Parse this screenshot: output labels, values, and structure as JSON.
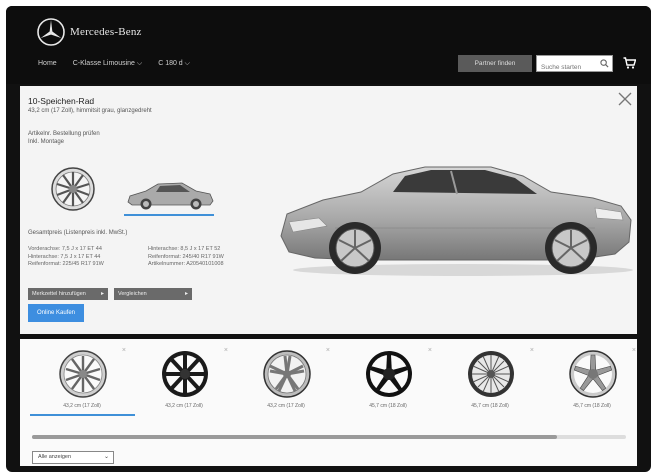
{
  "header": {
    "brand": "Mercedes-Benz",
    "nav": [
      "Home",
      "C-Klasse Limousine ⌵",
      "C 180 d ⌵"
    ],
    "dealer_button": "Partner finden",
    "search_placeholder": "Suche starten",
    "icons": {
      "logo": "mercedes-star-logo",
      "search": "search-icon",
      "cart": "cart-icon"
    }
  },
  "panel": {
    "title": "10-Speichen-Rad",
    "subtitle": "43,2 cm (17 Zoll), himmitsit grau, glanzgedreht",
    "info_lines": [
      "Artikelnr. Bestellung prüfen",
      "Inkl. Montage"
    ],
    "section_label": "Gesamtpreis (Listenpreis inkl. MwSt.)",
    "specs_left": [
      "Vorderachse: 7,5 J x 17 ET 44",
      "Hinterachse: 7,5 J x 17 ET 44",
      "Reifenformat: 225/45 R17 91W"
    ],
    "specs_right": [
      "Hinterachse: 8,5 J x 17 ET 52",
      "Reifenformat: 245/40 R17 91W",
      "Artikelnummer: A20540101008"
    ],
    "button_add": "Merkzettel hinzufügen",
    "button_compare": "Vergleichen",
    "button_primary": "Online Kaufen"
  },
  "wheels": [
    {
      "label": "43,2 cm (17 Zoll)",
      "selected": true,
      "style": "multispoke-silver"
    },
    {
      "label": "43,2 cm (17 Zoll)",
      "selected": false,
      "style": "black-multispoke"
    },
    {
      "label": "43,2 cm (17 Zoll)",
      "selected": false,
      "style": "silver-5-twin"
    },
    {
      "label": "45,7 cm (18 Zoll)",
      "selected": false,
      "style": "black-5-spoke"
    },
    {
      "label": "45,7 cm (18 Zoll)",
      "selected": false,
      "style": "mesh-silver"
    },
    {
      "label": "45,7 cm (18 Zoll)",
      "selected": false,
      "style": "silver-5-spoke"
    }
  ],
  "sort_label": "Alle anzeigen",
  "colors": {
    "accent": "#3f90d8",
    "button_blue": "#3d8ee0",
    "topbar": "#0d0d0d",
    "panel": "#f4f4f4"
  }
}
